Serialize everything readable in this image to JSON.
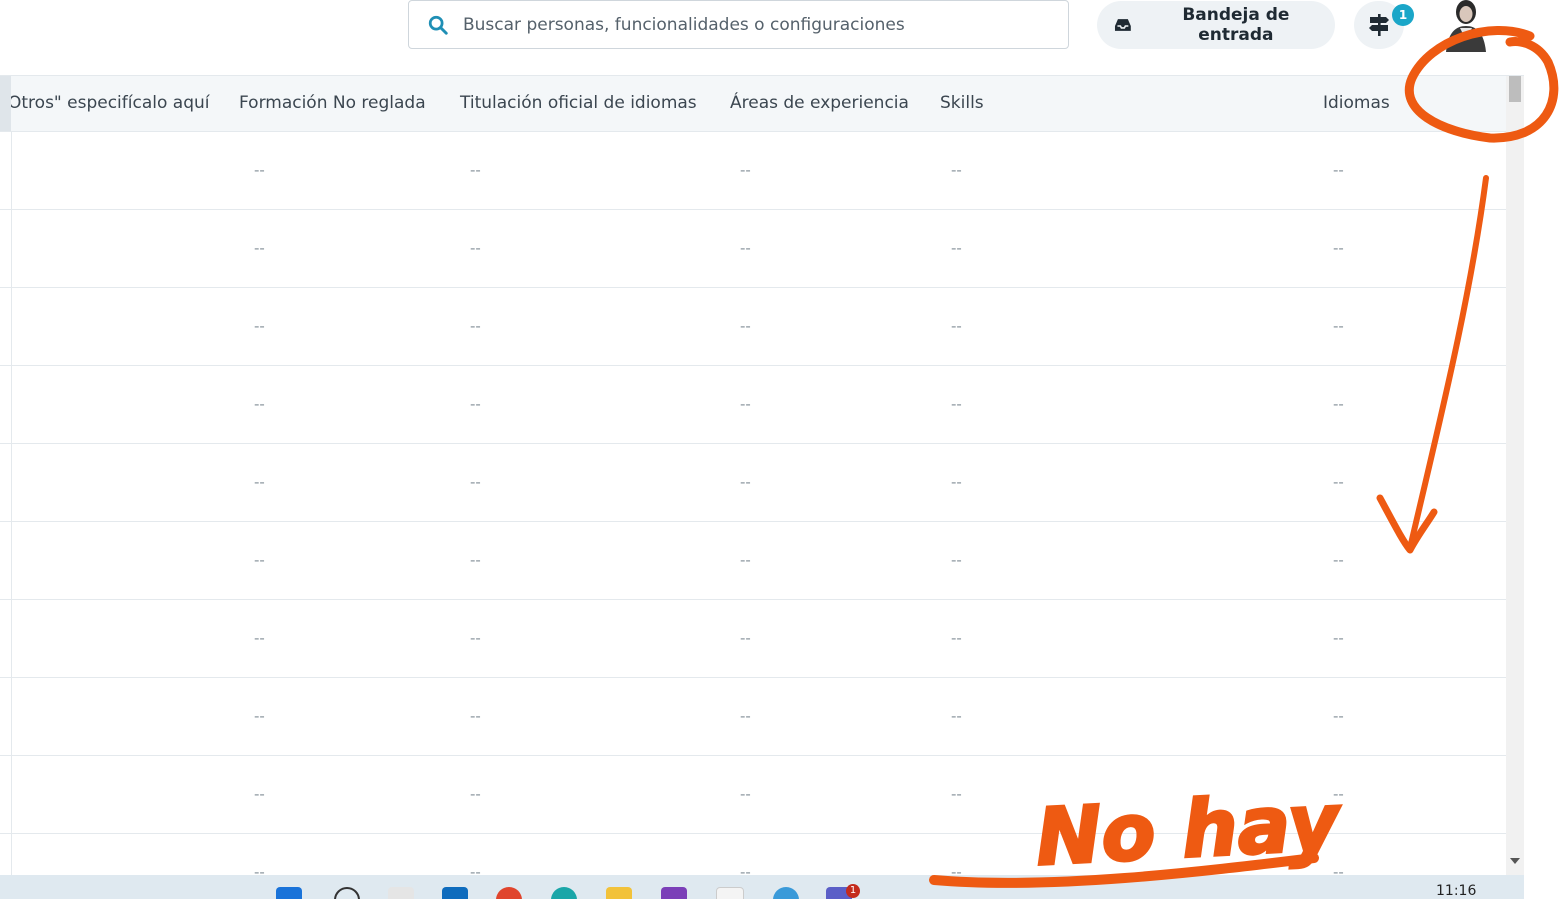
{
  "header": {
    "search_placeholder": "Buscar personas, funcionalidades o configuraciones",
    "inbox_label": "Bandeja de entrada",
    "notification_count": "1"
  },
  "table": {
    "columns": [
      "Otros\" especifícalo aquí",
      "Formación No reglada",
      "Titulación oficial de idiomas",
      "Áreas de experiencia",
      "Skills",
      "Idiomas"
    ],
    "empty_value": "--"
  },
  "taskbar": {
    "time": "11:16",
    "mail_badge": "1"
  },
  "annotation": {
    "text": "No hay",
    "color": "#ee5a12"
  }
}
